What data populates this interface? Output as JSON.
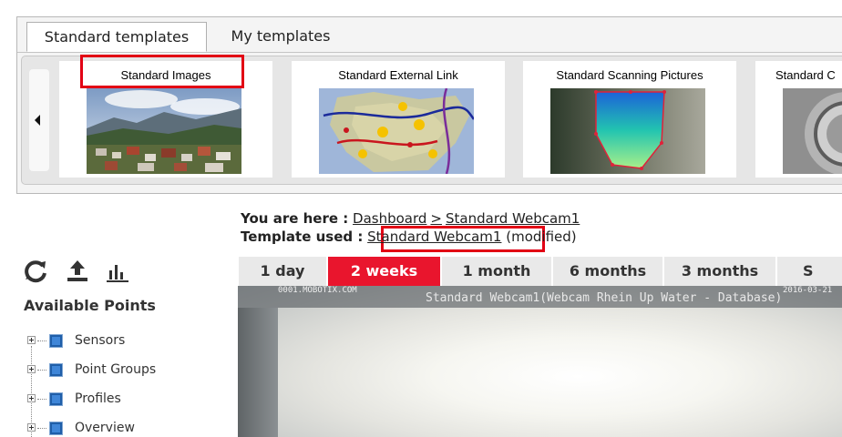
{
  "tabs": {
    "standard": "Standard templates",
    "my": "My templates"
  },
  "templates": [
    {
      "title": "Standard Images"
    },
    {
      "title": "Standard External Link"
    },
    {
      "title": "Standard Scanning Pictures"
    },
    {
      "title": "Standard C"
    }
  ],
  "breadcrumb": {
    "prefix": "You are here :",
    "dashboard": "Dashboard",
    "separator": ">",
    "current": "Standard Webcam1"
  },
  "template_used": {
    "prefix": "Template used :",
    "link": "Standard Webcam1",
    "suffix": "(modified)"
  },
  "sidebar": {
    "heading": "Available Points",
    "items": [
      {
        "label": "Sensors"
      },
      {
        "label": "Point Groups"
      },
      {
        "label": "Profiles"
      },
      {
        "label": "Overview"
      }
    ]
  },
  "periods": [
    {
      "label": "1 day",
      "active": false
    },
    {
      "label": "2 weeks",
      "active": true
    },
    {
      "label": "1 month",
      "active": false
    },
    {
      "label": "6 months",
      "active": false
    },
    {
      "label": "3 months",
      "active": false
    },
    {
      "label": "S",
      "active": false
    }
  ],
  "webcam": {
    "caption": "Standard Webcam1(Webcam Rhein Up Water - Database)",
    "stamp_left": "0001.MOBOTIX.COM",
    "stamp_right": "2016-03-21"
  },
  "colors": {
    "accent": "#e9152d",
    "highlight_box": "#e20014"
  }
}
